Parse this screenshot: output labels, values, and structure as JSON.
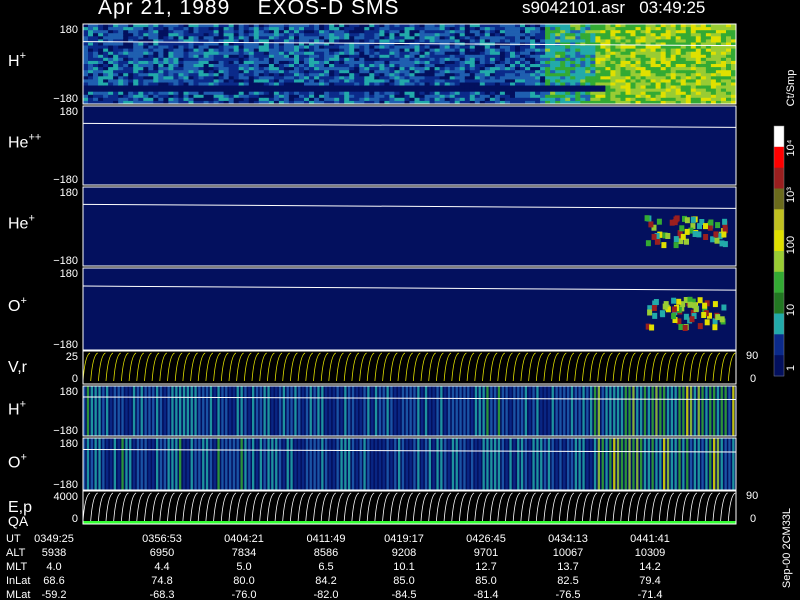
{
  "header": {
    "title": "Apr 21, 1989    EXOS-D SMS",
    "file": "s9042101.asr",
    "time": "03:49:25"
  },
  "panels": [
    {
      "id": "p1",
      "label_base": "H",
      "label_sup": "+",
      "kind": "spectrogram",
      "ymax": "180",
      "ymin": "−180",
      "palette": "h_plus"
    },
    {
      "id": "p2",
      "label_base": "He",
      "label_sup": "++",
      "kind": "spectrogram",
      "ymax": "180",
      "ymin": "−180",
      "palette": "dark"
    },
    {
      "id": "p3",
      "label_base": "He",
      "label_sup": "+",
      "kind": "spectrogram",
      "ymax": "180",
      "ymin": "−180",
      "palette": "dark_hot"
    },
    {
      "id": "p4",
      "label_base": "O",
      "label_sup": "+",
      "kind": "spectrogram",
      "ymax": "180",
      "ymin": "−180",
      "palette": "dark_hot"
    },
    {
      "id": "p5",
      "label_base": "V,r",
      "label_sup": "",
      "kind": "line",
      "ymax": "25",
      "ymin": "0",
      "right_top": "90",
      "right_bot": "0"
    },
    {
      "id": "p6",
      "label_base": "H",
      "label_sup": "+",
      "kind": "spectrogram",
      "ymax": "180",
      "ymin": "−180",
      "palette": "striped"
    },
    {
      "id": "p7",
      "label_base": "O",
      "label_sup": "+",
      "kind": "spectrogram",
      "ymax": "180",
      "ymin": "−180",
      "palette": "striped"
    },
    {
      "id": "p8",
      "label_base": "E,p",
      "label_sup": "",
      "label2": "QA",
      "kind": "line",
      "ymax": "4000",
      "ymin": "0",
      "right_top": "90",
      "right_bot": "0"
    }
  ],
  "colorbar": {
    "unit": "Ct/Smp",
    "ticks": [
      "10⁴",
      "10³",
      "100",
      "10",
      "1"
    ],
    "colors": [
      "#ffffff",
      "#ff0000",
      "#9a1f1f",
      "#6b6b1c",
      "#c0c020",
      "#e0e000",
      "#99cc33",
      "#33aa33",
      "#227722",
      "#22aaaa",
      "#0b2a8a",
      "#03105e"
    ]
  },
  "footer": {
    "rows": [
      {
        "name": "UT",
        "values": [
          "0349:25",
          "0356:53",
          "0404:21",
          "0411:49",
          "0419:17",
          "0426:45",
          "0434:13",
          "0441:41"
        ]
      },
      {
        "name": "ALT",
        "values": [
          "5938",
          "6950",
          "7834",
          "8586",
          "9208",
          "9701",
          "10067",
          "10309"
        ]
      },
      {
        "name": "MLT",
        "values": [
          "4.0",
          "4.4",
          "5.0",
          "6.5",
          "10.1",
          "12.7",
          "13.7",
          "14.2"
        ]
      },
      {
        "name": "InLat",
        "values": [
          "68.6",
          "74.8",
          "80.0",
          "84.2",
          "85.0",
          "85.0",
          "82.5",
          "79.4"
        ]
      },
      {
        "name": "MLat",
        "values": [
          "-59.2",
          "-68.3",
          "-76.0",
          "-82.0",
          "-84.5",
          "-81.4",
          "-76.5",
          "-71.4"
        ]
      }
    ],
    "stamp": "Sep-00  2CM33L"
  }
}
